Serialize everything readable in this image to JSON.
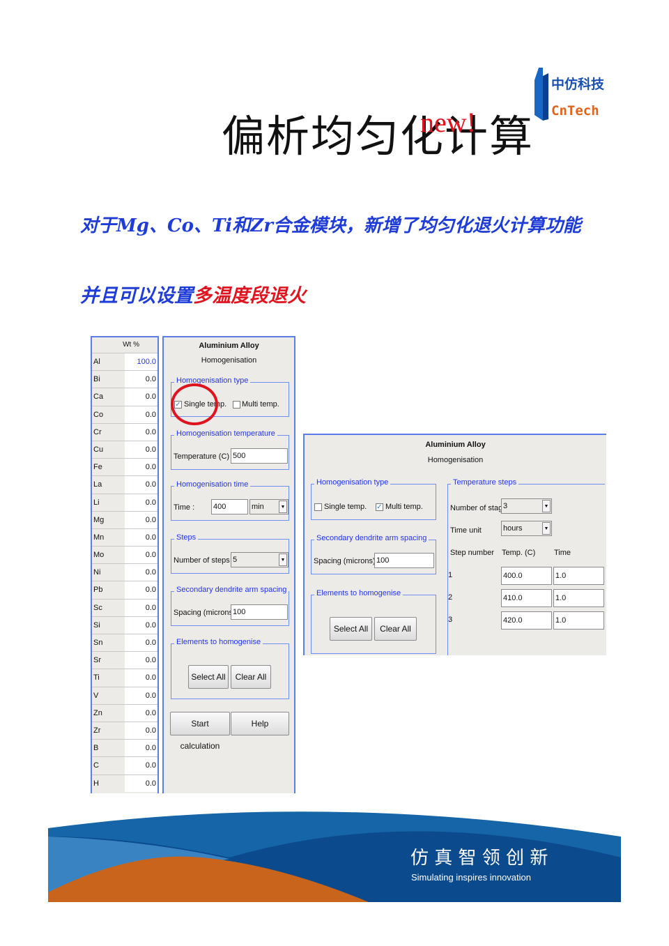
{
  "title": "偏析均匀化计算",
  "title_badge": "new!",
  "logo": {
    "cn": "中仿科技",
    "en": "CnTech"
  },
  "line1": "对于Mg、Co、Ti和Zr合金模块，新增了均匀化退火计算功能",
  "line2_blue": "并且可以设置",
  "line2_red": "多温度段退火",
  "composition": {
    "header": "Wt %",
    "rows": [
      {
        "el": "Al",
        "v": "100.0"
      },
      {
        "el": "Bi",
        "v": "0.0"
      },
      {
        "el": "Ca",
        "v": "0.0"
      },
      {
        "el": "Co",
        "v": "0.0"
      },
      {
        "el": "Cr",
        "v": "0.0"
      },
      {
        "el": "Cu",
        "v": "0.0"
      },
      {
        "el": "Fe",
        "v": "0.0"
      },
      {
        "el": "La",
        "v": "0.0"
      },
      {
        "el": "Li",
        "v": "0.0"
      },
      {
        "el": "Mg",
        "v": "0.0"
      },
      {
        "el": "Mn",
        "v": "0.0"
      },
      {
        "el": "Mo",
        "v": "0.0"
      },
      {
        "el": "Ni",
        "v": "0.0"
      },
      {
        "el": "Pb",
        "v": "0.0"
      },
      {
        "el": "Sc",
        "v": "0.0"
      },
      {
        "el": "Si",
        "v": "0.0"
      },
      {
        "el": "Sn",
        "v": "0.0"
      },
      {
        "el": "Sr",
        "v": "0.0"
      },
      {
        "el": "Ti",
        "v": "0.0"
      },
      {
        "el": "V",
        "v": "0.0"
      },
      {
        "el": "Zn",
        "v": "0.0"
      },
      {
        "el": "Zr",
        "v": "0.0"
      },
      {
        "el": "B",
        "v": "0.0"
      },
      {
        "el": "C",
        "v": "0.0"
      },
      {
        "el": "H",
        "v": "0.0"
      }
    ]
  },
  "single": {
    "alloy": "Aluminium Alloy",
    "module": "Homogenisation",
    "type_legend": "Homogenisation type",
    "single_label": "Single temp.",
    "multi_label": "Multi temp.",
    "single_checked": true,
    "multi_checked": false,
    "temp_legend": "Homogenisation temperature",
    "temp_label": "Temperature (C)",
    "temp_value": "500",
    "time_legend": "Homogenisation time",
    "time_label": "Time :",
    "time_value": "400",
    "time_unit": "min",
    "steps_legend": "Steps",
    "steps_label": "Number of steps",
    "steps_value": "5",
    "sdas_legend": "Secondary dendrite arm spacing",
    "sdas_label": "Spacing (microns)",
    "sdas_value": "100",
    "elements_legend": "Elements to homogenise",
    "select_all": "Select All",
    "clear_all": "Clear All",
    "start": "Start calculation",
    "help": "Help"
  },
  "multi": {
    "alloy": "Aluminium Alloy",
    "module": "Homogenisation",
    "type_legend": "Homogenisation type",
    "single_label": "Single temp.",
    "multi_label": "Multi temp.",
    "single_checked": false,
    "multi_checked": true,
    "sdas_legend": "Secondary dendrite arm spacing",
    "sdas_label": "Spacing (microns)",
    "sdas_value": "100",
    "elements_legend": "Elements to homogenise",
    "select_all": "Select All",
    "clear_all": "Clear All",
    "steps_legend": "Temperature steps",
    "stages_label": "Number of stages:",
    "stages_value": "3",
    "unit_label": "Time unit",
    "unit_value": "hours",
    "col_step": "Step number",
    "col_temp": "Temp. (C)",
    "col_time": "Time",
    "steps": [
      {
        "n": "1",
        "temp": "400.0",
        "time": "1.0"
      },
      {
        "n": "2",
        "temp": "410.0",
        "time": "1.0"
      },
      {
        "n": "3",
        "temp": "420.0",
        "time": "1.0"
      }
    ]
  },
  "banner": {
    "cn": "仿 真 智 领 创 新",
    "en": "Simulating inspires innovation"
  },
  "colors": {
    "accent_blue": "#1f3dd6",
    "accent_red": "#e0141e",
    "panel_border": "#5b7de8",
    "banner_dark": "#0b4a8c",
    "banner_orange": "#c9641c"
  }
}
